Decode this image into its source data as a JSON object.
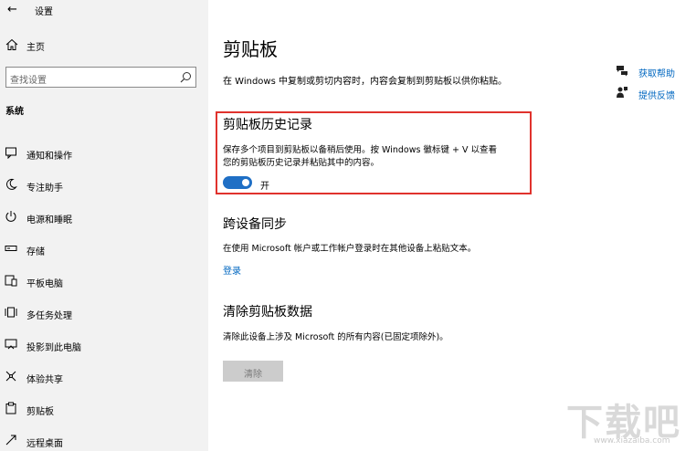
{
  "window": {
    "title": "设置"
  },
  "sidebar": {
    "home_label": "主页",
    "search_placeholder": "查找设置",
    "section_label": "系统",
    "items": [
      {
        "label": "通知和操作",
        "icon": "notification-icon"
      },
      {
        "label": "专注助手",
        "icon": "moon-icon"
      },
      {
        "label": "电源和睡眠",
        "icon": "power-icon"
      },
      {
        "label": "存储",
        "icon": "storage-icon"
      },
      {
        "label": "平板电脑",
        "icon": "tablet-icon"
      },
      {
        "label": "多任务处理",
        "icon": "multitask-icon"
      },
      {
        "label": "投影到此电脑",
        "icon": "project-icon"
      },
      {
        "label": "体验共享",
        "icon": "share-icon"
      },
      {
        "label": "剪贴板",
        "icon": "clipboard-icon"
      },
      {
        "label": "远程桌面",
        "icon": "remote-desktop-icon"
      }
    ]
  },
  "main": {
    "title": "剪贴板",
    "description": "在 Windows 中复制或剪切内容时，内容会复制到剪贴板以供你粘贴。",
    "history": {
      "heading": "剪贴板历史记录",
      "text_line1": "保存多个项目到剪贴板以备稍后使用。按 Windows 徽标键 + V 以查看",
      "text_line2": "您的剪贴板历史记录并粘贴其中的内容。",
      "toggle_state": "开",
      "toggle_on": true
    },
    "sync": {
      "heading": "跨设备同步",
      "text": "在使用 Microsoft 帐户或工作帐户登录时在其他设备上粘贴文本。",
      "link": "登录"
    },
    "clear": {
      "heading": "清除剪贴板数据",
      "text": "清除此设备上涉及 Microsoft 的所有内容(已固定项除外)。",
      "button": "清除"
    },
    "help_links": [
      {
        "label": "获取帮助",
        "icon": "help-chat-icon"
      },
      {
        "label": "提供反馈",
        "icon": "feedback-icon"
      }
    ]
  },
  "watermark": {
    "big": "下载吧",
    "small": "www.xiazaiba.com"
  },
  "colors": {
    "accent": "#1f6fc5",
    "link": "#0067c0",
    "highlight_border": "#e0322d",
    "sidebar_bg": "#f2f2f2"
  }
}
